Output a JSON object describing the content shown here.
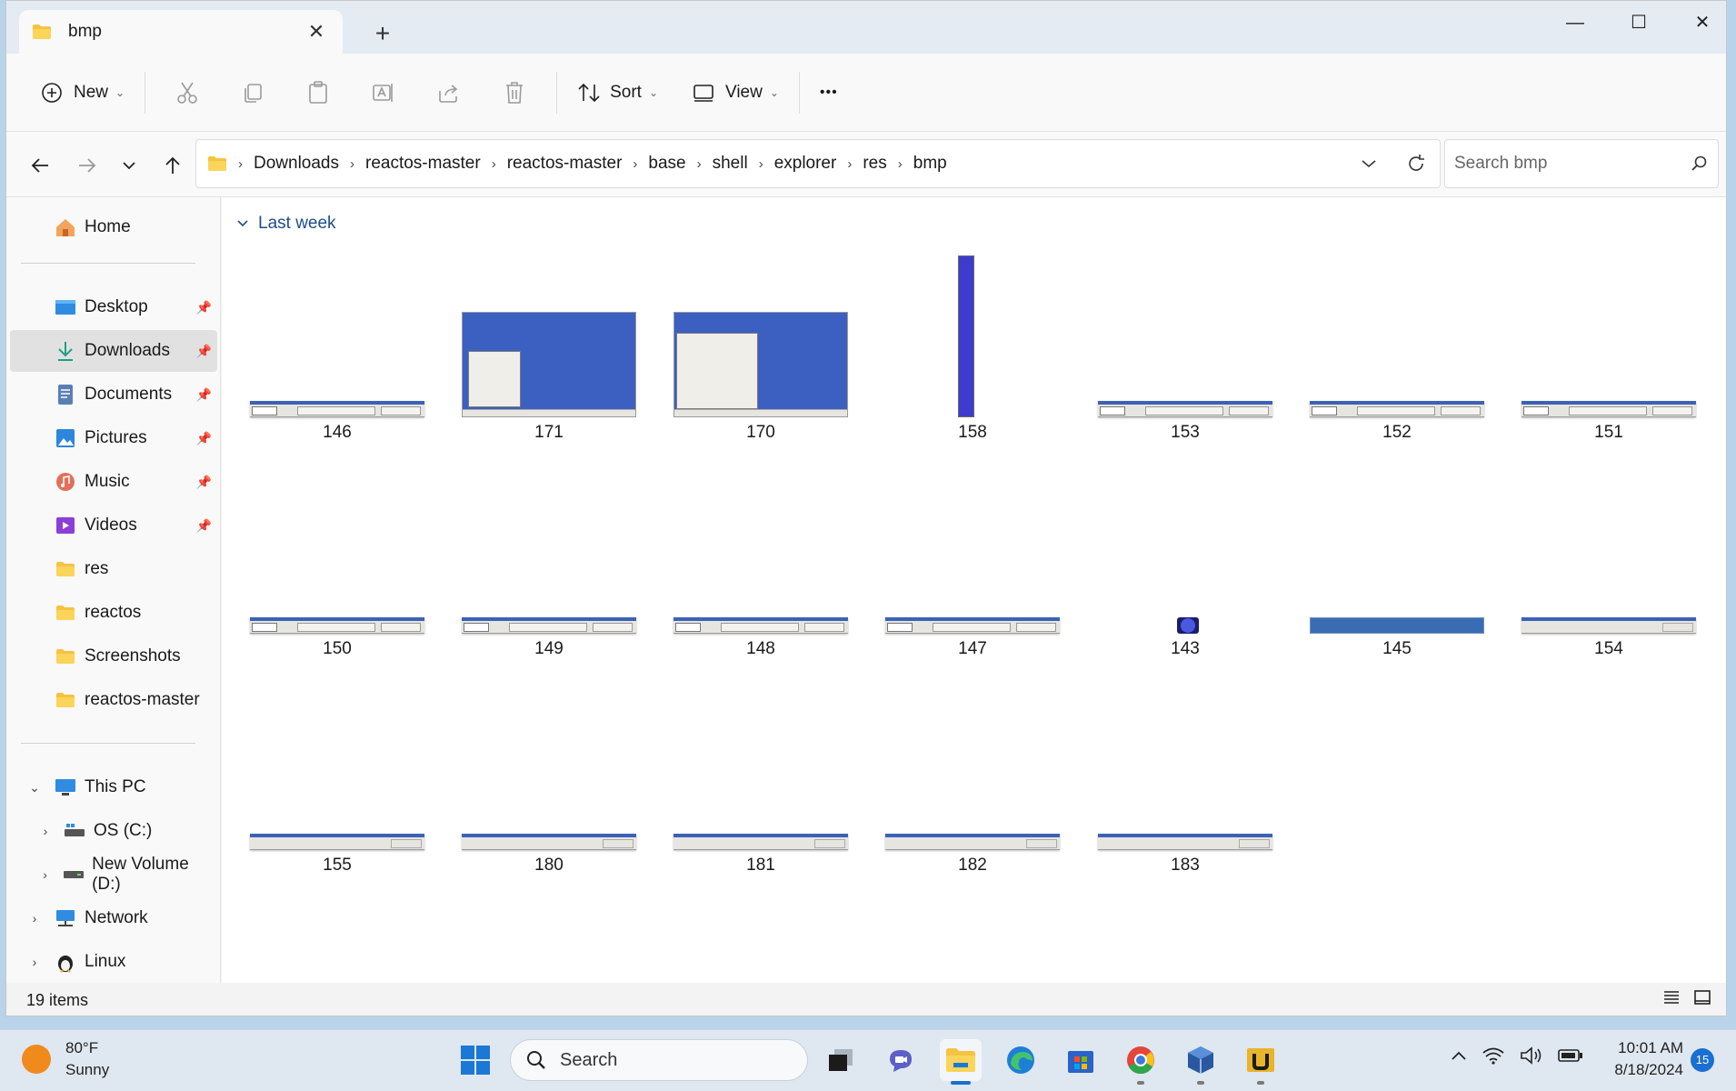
{
  "window": {
    "tab_title": "bmp",
    "close_tab_glyph": "✕",
    "new_tab_glyph": "+",
    "minimize_glyph": "—",
    "maximize_glyph": "☐",
    "close_glyph": "✕"
  },
  "toolbar": {
    "new_label": "New",
    "sort_label": "Sort",
    "view_label": "View",
    "more_glyph": "•••",
    "caret": "⌄",
    "icons": [
      "cut-icon",
      "copy-icon",
      "paste-icon",
      "rename-icon",
      "share-icon",
      "delete-icon"
    ]
  },
  "address": {
    "crumbs": [
      "Downloads",
      "reactos-master",
      "reactos-master",
      "base",
      "shell",
      "explorer",
      "res",
      "bmp"
    ],
    "separator": "›"
  },
  "search": {
    "placeholder": "Search bmp"
  },
  "nav": {
    "home": "Home",
    "quick_access": [
      {
        "label": "Desktop",
        "icon": "desktop-icon",
        "pinned": true
      },
      {
        "label": "Downloads",
        "icon": "downloads-icon",
        "pinned": true,
        "selected": true
      },
      {
        "label": "Documents",
        "icon": "documents-icon",
        "pinned": true
      },
      {
        "label": "Pictures",
        "icon": "pictures-icon",
        "pinned": true
      },
      {
        "label": "Music",
        "icon": "music-icon",
        "pinned": true
      },
      {
        "label": "Videos",
        "icon": "videos-icon",
        "pinned": true
      },
      {
        "label": "res",
        "icon": "folder-icon"
      },
      {
        "label": "reactos",
        "icon": "folder-icon"
      },
      {
        "label": "Screenshots",
        "icon": "folder-icon"
      },
      {
        "label": "reactos-master",
        "icon": "folder-icon"
      }
    ],
    "this_pc": "This PC",
    "drives": [
      "OS (C:)",
      "New Volume (D:)"
    ],
    "network": "Network",
    "linux": "Linux"
  },
  "content": {
    "group_header": "Last week",
    "files": [
      "146",
      "171",
      "170",
      "158",
      "153",
      "152",
      "151",
      "150",
      "149",
      "148",
      "147",
      "143",
      "145",
      "154",
      "155",
      "180",
      "181",
      "182",
      "183"
    ]
  },
  "status": {
    "item_count": "19 items"
  },
  "taskbar": {
    "temperature": "80°F",
    "condition": "Sunny",
    "search_label": "Search",
    "time": "10:01 AM",
    "date": "8/18/2024",
    "notification_count": "15"
  },
  "colors": {
    "accent": "#1a6fd1",
    "folder": "#f5c242",
    "thumb_blue": "#3c5fc2",
    "taskbar_blue": "#3c62b6"
  }
}
